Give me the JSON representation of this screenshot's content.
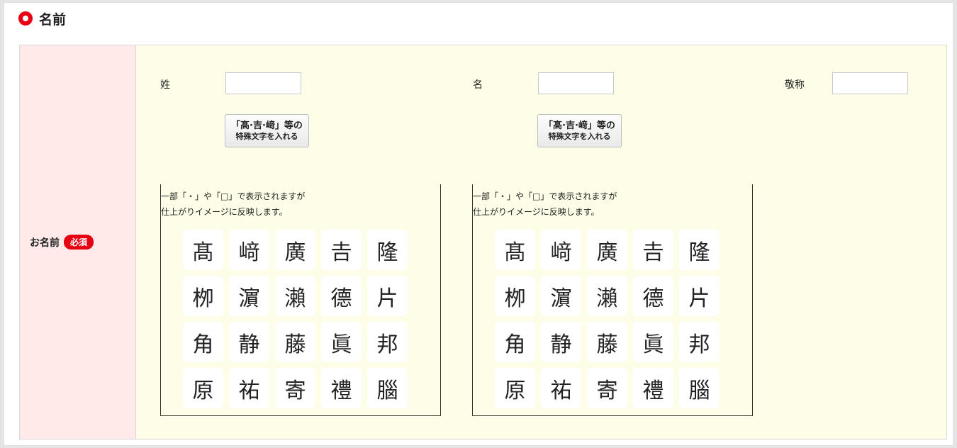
{
  "section": {
    "title": "名前"
  },
  "field": {
    "label": "お名前",
    "required_badge": "必須"
  },
  "inputs": {
    "sei_label": "姓",
    "mei_label": "名",
    "keisho_label": "敬称",
    "sei_value": "",
    "mei_value": "",
    "keisho_value": ""
  },
  "special_button": {
    "line1": "「髙·吉·﨑」等の",
    "line2": "特殊文字を入れる"
  },
  "panel_note": {
    "line1": "一部「・」や「□」で表示されますが",
    "line2": "仕上がりイメージに反映します。"
  },
  "chars": [
    "髙",
    "﨑",
    "廣",
    "𠮷",
    "隆",
    "栁",
    "濵",
    "瀨",
    "德",
    "片",
    "角",
    "静",
    "藤",
    "眞",
    "邦",
    "原",
    "祐",
    "寄",
    "禮",
    "腦"
  ],
  "colors": {
    "accent": "#e60012",
    "header_bg": "#ffe9e9",
    "body_bg": "#fdfde8"
  },
  "icons": {
    "section_marker": "circle-bullet-icon"
  }
}
